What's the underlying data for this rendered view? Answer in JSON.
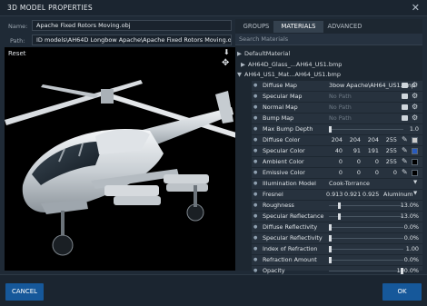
{
  "window": {
    "title": "3D MODEL PROPERTIES",
    "close_glyph": "✕"
  },
  "name_label": "Name:",
  "name_value": "Apache Fixed Rotors Moving.obj",
  "path_label": "Path:",
  "path_value": "ID models\\AH64D Longbow Apache\\Apache Fixed Rotors Moving.obj",
  "viewport": {
    "reset": "Reset"
  },
  "tabs": [
    {
      "label": "GROUPS",
      "active": false
    },
    {
      "label": "MATERIALS",
      "active": true
    },
    {
      "label": "ADVANCED",
      "active": false
    }
  ],
  "search_placeholder": "Search Materials",
  "tree": [
    {
      "arrow": "▶",
      "label": "DefaultMaterial"
    },
    {
      "arrow": "▶",
      "label": "AH64D_Glass_...AH64_US1.bmp"
    },
    {
      "arrow": "▼",
      "label": "AH64_US1_Mat...AH64_US1.bmp"
    }
  ],
  "properties": {
    "diffuse_map": {
      "label": "Diffuse Map",
      "value": "3bow Apache\\AH64_US1.bmp"
    },
    "specular_map": {
      "label": "Specular Map",
      "value": "No Path"
    },
    "normal_map": {
      "label": "Normal Map",
      "value": "No Path"
    },
    "bump_map": {
      "label": "Bump Map",
      "value": "No Path"
    },
    "max_bump_depth": {
      "label": "Max Bump Depth",
      "value": "1.0",
      "level": 0.0
    },
    "diffuse_color": {
      "label": "Diffuse Color",
      "r": "204",
      "g": "204",
      "b": "204",
      "a": "255",
      "swatch": "#cccccc"
    },
    "specular_color": {
      "label": "Specular Color",
      "r": "40",
      "g": "91",
      "b": "191",
      "a": "255",
      "swatch": "#285bbf"
    },
    "ambient_color": {
      "label": "Ambient Color",
      "r": "0",
      "g": "0",
      "b": "0",
      "a": "255",
      "swatch": "#000000"
    },
    "emissive_color": {
      "label": "Emissive Color",
      "r": "0",
      "g": "0",
      "b": "0",
      "a": "0",
      "swatch": "#000000"
    },
    "illumination_model": {
      "label": "Illumination Model",
      "value": "Cook-Torrance"
    },
    "fresnel": {
      "label": "Fresnel",
      "v1": "0.913",
      "v2": "0.921",
      "v3": "0.925",
      "preset": "Aluminum"
    },
    "roughness": {
      "label": "Roughness",
      "value": "13.0%",
      "level": 0.13
    },
    "specular_reflectance": {
      "label": "Specular Reflectance",
      "value": "13.0%",
      "level": 0.13
    },
    "diffuse_reflectivity": {
      "label": "Diffuse Reflectivity",
      "value": "0.0%",
      "level": 0.0
    },
    "specular_reflectivity": {
      "label": "Specular Reflectivity",
      "value": "0.0%",
      "level": 0.0
    },
    "index_of_refraction": {
      "label": "Index of Refraction",
      "value": "1.00",
      "level": 0.0
    },
    "refraction_amount": {
      "label": "Refraction Amount",
      "value": "0.0%",
      "level": 0.0
    },
    "opacity": {
      "label": "Opacity",
      "value": "100.0%",
      "level": 1.0
    }
  },
  "footer": {
    "cancel": "CANCEL",
    "ok": "OK"
  }
}
